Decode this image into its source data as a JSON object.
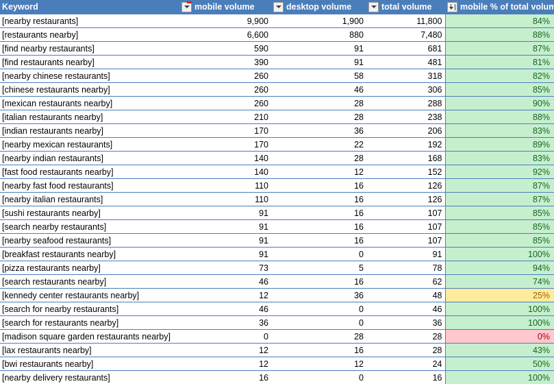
{
  "table": {
    "columns": [
      {
        "key": "keyword",
        "label": "Keyword",
        "align": "left",
        "filter": "dropdown",
        "marker": "red"
      },
      {
        "key": "mobile",
        "label": "mobile volume",
        "align": "right",
        "filter": "dropdown"
      },
      {
        "key": "desktop",
        "label": "desktop volume",
        "align": "right",
        "filter": "dropdown"
      },
      {
        "key": "total",
        "label": "total volume",
        "align": "right",
        "filter": "dropdown"
      },
      {
        "key": "pct",
        "label": "mobile % of total volume",
        "align": "right",
        "filter": "sort-descending"
      }
    ],
    "header_icons": {
      "dropdown": "filter-dropdown-icon",
      "sort_descending": "sort-descending-filter-icon"
    },
    "colors": {
      "header_background": "#4a7ebb",
      "header_text": "#ffffff",
      "grid_line": "#4a7ebb",
      "pct_green_bg": "#c6efce",
      "pct_green_text": "#17651f",
      "pct_yellow_bg": "#ffeb9c",
      "pct_yellow_text": "#9c6500",
      "pct_red_bg": "#ffc7ce",
      "pct_red_text": "#9c0006"
    },
    "rows": [
      {
        "keyword": "[nearby restaurants]",
        "mobile": "9,900",
        "desktop": "1,900",
        "total": "11,800",
        "pct": "84%",
        "pct_state": "green"
      },
      {
        "keyword": "[restaurants nearby]",
        "mobile": "6,600",
        "desktop": "880",
        "total": "7,480",
        "pct": "88%",
        "pct_state": "green"
      },
      {
        "keyword": "[find nearby restaurants]",
        "mobile": "590",
        "desktop": "91",
        "total": "681",
        "pct": "87%",
        "pct_state": "green"
      },
      {
        "keyword": "[find restaurants nearby]",
        "mobile": "390",
        "desktop": "91",
        "total": "481",
        "pct": "81%",
        "pct_state": "green"
      },
      {
        "keyword": "[nearby chinese restaurants]",
        "mobile": "260",
        "desktop": "58",
        "total": "318",
        "pct": "82%",
        "pct_state": "green"
      },
      {
        "keyword": "[chinese restaurants nearby]",
        "mobile": "260",
        "desktop": "46",
        "total": "306",
        "pct": "85%",
        "pct_state": "green"
      },
      {
        "keyword": "[mexican restaurants nearby]",
        "mobile": "260",
        "desktop": "28",
        "total": "288",
        "pct": "90%",
        "pct_state": "green"
      },
      {
        "keyword": "[italian restaurants nearby]",
        "mobile": "210",
        "desktop": "28",
        "total": "238",
        "pct": "88%",
        "pct_state": "green"
      },
      {
        "keyword": "[indian restaurants nearby]",
        "mobile": "170",
        "desktop": "36",
        "total": "206",
        "pct": "83%",
        "pct_state": "green"
      },
      {
        "keyword": "[nearby mexican restaurants]",
        "mobile": "170",
        "desktop": "22",
        "total": "192",
        "pct": "89%",
        "pct_state": "green"
      },
      {
        "keyword": "[nearby indian restaurants]",
        "mobile": "140",
        "desktop": "28",
        "total": "168",
        "pct": "83%",
        "pct_state": "green"
      },
      {
        "keyword": "[fast food restaurants nearby]",
        "mobile": "140",
        "desktop": "12",
        "total": "152",
        "pct": "92%",
        "pct_state": "green"
      },
      {
        "keyword": "[nearby fast food restaurants]",
        "mobile": "110",
        "desktop": "16",
        "total": "126",
        "pct": "87%",
        "pct_state": "green"
      },
      {
        "keyword": "[nearby italian restaurants]",
        "mobile": "110",
        "desktop": "16",
        "total": "126",
        "pct": "87%",
        "pct_state": "green"
      },
      {
        "keyword": "[sushi restaurants nearby]",
        "mobile": "91",
        "desktop": "16",
        "total": "107",
        "pct": "85%",
        "pct_state": "green"
      },
      {
        "keyword": "[search nearby restaurants]",
        "mobile": "91",
        "desktop": "16",
        "total": "107",
        "pct": "85%",
        "pct_state": "green"
      },
      {
        "keyword": "[nearby seafood restaurants]",
        "mobile": "91",
        "desktop": "16",
        "total": "107",
        "pct": "85%",
        "pct_state": "green"
      },
      {
        "keyword": "[breakfast restaurants nearby]",
        "mobile": "91",
        "desktop": "0",
        "total": "91",
        "pct": "100%",
        "pct_state": "green"
      },
      {
        "keyword": "[pizza restaurants nearby]",
        "mobile": "73",
        "desktop": "5",
        "total": "78",
        "pct": "94%",
        "pct_state": "green"
      },
      {
        "keyword": "[search restaurants nearby]",
        "mobile": "46",
        "desktop": "16",
        "total": "62",
        "pct": "74%",
        "pct_state": "green"
      },
      {
        "keyword": "[kennedy center restaurants nearby]",
        "mobile": "12",
        "desktop": "36",
        "total": "48",
        "pct": "25%",
        "pct_state": "yellow"
      },
      {
        "keyword": "[search for nearby restaurants]",
        "mobile": "46",
        "desktop": "0",
        "total": "46",
        "pct": "100%",
        "pct_state": "green"
      },
      {
        "keyword": "[search for restaurants nearby]",
        "mobile": "36",
        "desktop": "0",
        "total": "36",
        "pct": "100%",
        "pct_state": "green"
      },
      {
        "keyword": "[madison square garden restaurants nearby]",
        "mobile": "0",
        "desktop": "28",
        "total": "28",
        "pct": "0%",
        "pct_state": "red"
      },
      {
        "keyword": "[lax restaurants nearby]",
        "mobile": "12",
        "desktop": "16",
        "total": "28",
        "pct": "43%",
        "pct_state": "green"
      },
      {
        "keyword": "[bwi restaurants nearby]",
        "mobile": "12",
        "desktop": "12",
        "total": "24",
        "pct": "50%",
        "pct_state": "green"
      },
      {
        "keyword": "[nearby delivery restaurants]",
        "mobile": "16",
        "desktop": "0",
        "total": "16",
        "pct": "100%",
        "pct_state": "green"
      }
    ]
  }
}
